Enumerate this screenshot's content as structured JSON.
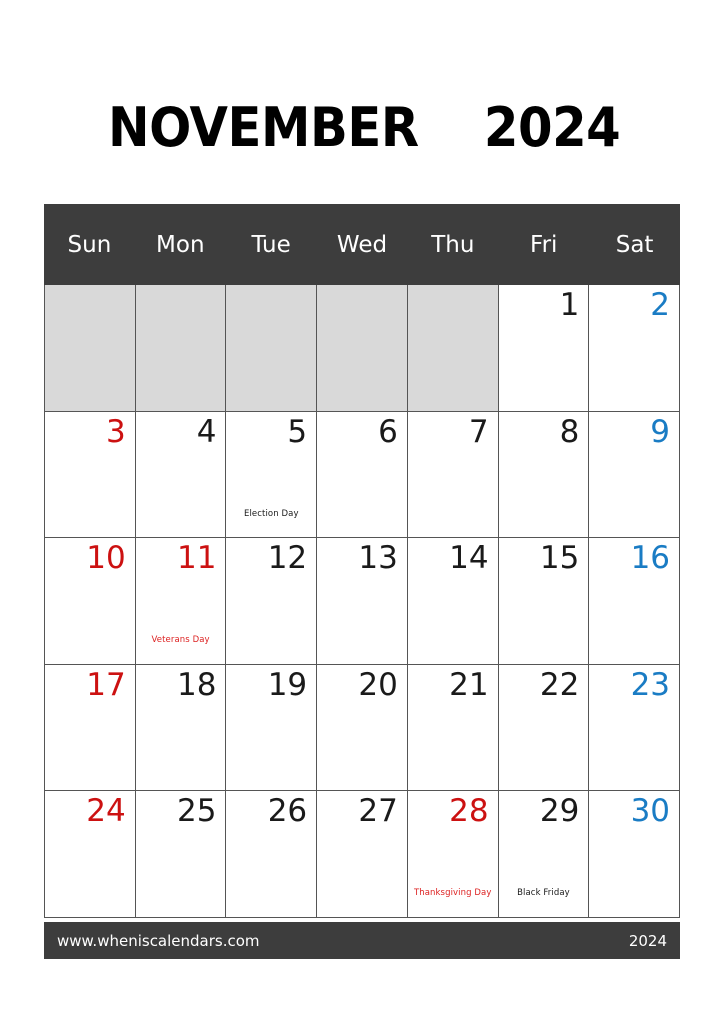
{
  "title": {
    "month": "NOVEMBER",
    "year": "2024"
  },
  "colors": {
    "header_bg": "#3d3d3d",
    "footer_bg": "#3d3d3d",
    "blank_cell": "#d9d9d9",
    "grid_line": "#555555",
    "sunday": "#cc1111",
    "saturday": "#1a7cc4",
    "weekday": "#1a1a1a",
    "holiday": "#cc1111",
    "page_bg": "#ffffff"
  },
  "weekdays": [
    {
      "label": "Sun"
    },
    {
      "label": "Mon"
    },
    {
      "label": "Tue"
    },
    {
      "label": "Wed"
    },
    {
      "label": "Thu"
    },
    {
      "label": "Fri"
    },
    {
      "label": "Sat"
    }
  ],
  "weeks": [
    [
      {
        "day": "",
        "blank": true,
        "kind": "blank",
        "event": ""
      },
      {
        "day": "",
        "blank": true,
        "kind": "blank",
        "event": ""
      },
      {
        "day": "",
        "blank": true,
        "kind": "blank",
        "event": ""
      },
      {
        "day": "",
        "blank": true,
        "kind": "blank",
        "event": ""
      },
      {
        "day": "",
        "blank": true,
        "kind": "blank",
        "event": ""
      },
      {
        "day": "1",
        "blank": false,
        "kind": "weekday",
        "event": ""
      },
      {
        "day": "2",
        "blank": false,
        "kind": "sat",
        "event": ""
      }
    ],
    [
      {
        "day": "3",
        "blank": false,
        "kind": "sun",
        "event": ""
      },
      {
        "day": "4",
        "blank": false,
        "kind": "weekday",
        "event": ""
      },
      {
        "day": "5",
        "blank": false,
        "kind": "weekday",
        "event": "Election Day",
        "event_color": "black"
      },
      {
        "day": "6",
        "blank": false,
        "kind": "weekday",
        "event": ""
      },
      {
        "day": "7",
        "blank": false,
        "kind": "weekday",
        "event": ""
      },
      {
        "day": "8",
        "blank": false,
        "kind": "weekday",
        "event": ""
      },
      {
        "day": "9",
        "blank": false,
        "kind": "sat",
        "event": ""
      }
    ],
    [
      {
        "day": "10",
        "blank": false,
        "kind": "sun",
        "event": ""
      },
      {
        "day": "11",
        "blank": false,
        "kind": "holi",
        "event": "Veterans Day",
        "event_color": "red"
      },
      {
        "day": "12",
        "blank": false,
        "kind": "weekday",
        "event": ""
      },
      {
        "day": "13",
        "blank": false,
        "kind": "weekday",
        "event": ""
      },
      {
        "day": "14",
        "blank": false,
        "kind": "weekday",
        "event": ""
      },
      {
        "day": "15",
        "blank": false,
        "kind": "weekday",
        "event": ""
      },
      {
        "day": "16",
        "blank": false,
        "kind": "sat",
        "event": ""
      }
    ],
    [
      {
        "day": "17",
        "blank": false,
        "kind": "sun",
        "event": ""
      },
      {
        "day": "18",
        "blank": false,
        "kind": "weekday",
        "event": ""
      },
      {
        "day": "19",
        "blank": false,
        "kind": "weekday",
        "event": ""
      },
      {
        "day": "20",
        "blank": false,
        "kind": "weekday",
        "event": ""
      },
      {
        "day": "21",
        "blank": false,
        "kind": "weekday",
        "event": ""
      },
      {
        "day": "22",
        "blank": false,
        "kind": "weekday",
        "event": ""
      },
      {
        "day": "23",
        "blank": false,
        "kind": "sat",
        "event": ""
      }
    ],
    [
      {
        "day": "24",
        "blank": false,
        "kind": "sun",
        "event": ""
      },
      {
        "day": "25",
        "blank": false,
        "kind": "weekday",
        "event": ""
      },
      {
        "day": "26",
        "blank": false,
        "kind": "weekday",
        "event": ""
      },
      {
        "day": "27",
        "blank": false,
        "kind": "weekday",
        "event": ""
      },
      {
        "day": "28",
        "blank": false,
        "kind": "holi",
        "event": "Thanksgiving Day",
        "event_color": "red"
      },
      {
        "day": "29",
        "blank": false,
        "kind": "weekday",
        "event": "Black Friday",
        "event_color": "black"
      },
      {
        "day": "30",
        "blank": false,
        "kind": "sat",
        "event": ""
      }
    ]
  ],
  "footer": {
    "site": "www.wheniscalendars.com",
    "year": "2024"
  }
}
